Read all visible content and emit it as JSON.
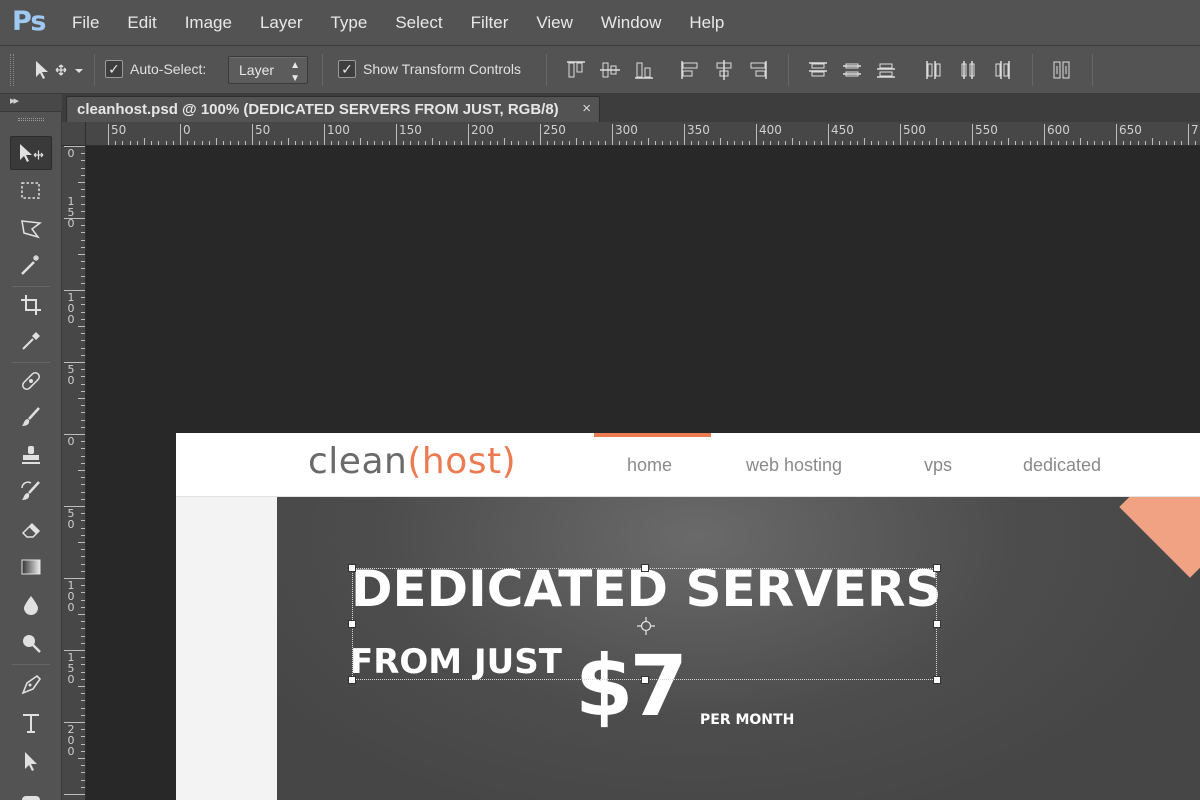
{
  "app": {
    "logo": "Ps",
    "menu": [
      "File",
      "Edit",
      "Image",
      "Layer",
      "Type",
      "Select",
      "Filter",
      "View",
      "Window",
      "Help"
    ]
  },
  "options_bar": {
    "auto_select_label": "Auto-Select:",
    "auto_select_checked": true,
    "auto_select_target": "Layer",
    "show_transform_label": "Show Transform Controls",
    "show_transform_checked": true,
    "align_icons": [
      "align-top-edges-icon",
      "align-vertical-centers-icon",
      "align-bottom-edges-icon",
      "align-left-edges-icon",
      "align-horizontal-centers-icon",
      "align-right-edges-icon",
      "distribute-top-icon",
      "distribute-vertical-centers-icon",
      "distribute-bottom-icon",
      "distribute-left-icon",
      "distribute-horizontal-centers-icon",
      "distribute-right-icon",
      "auto-align-layers-icon"
    ]
  },
  "document": {
    "tab_title": "cleanhost.psd @ 100% (DEDICATED SERVERS FROM JUST, RGB/8)",
    "close_glyph": "×"
  },
  "rulers": {
    "horizontal_labels": [
      "50",
      "0",
      "50",
      "100",
      "150",
      "200",
      "250",
      "300",
      "350",
      "400",
      "450",
      "500",
      "550",
      "600",
      "650",
      "7"
    ],
    "vertical_labels": [
      "0",
      "150",
      "100",
      "50",
      "0",
      "50",
      "100",
      "150",
      "200"
    ]
  },
  "tools": [
    "move-tool",
    "marquee-tool",
    "lasso-tool",
    "magic-wand-tool",
    "crop-tool",
    "eyedropper-tool",
    "healing-brush-tool",
    "brush-tool",
    "clone-stamp-tool",
    "history-brush-tool",
    "eraser-tool",
    "gradient-tool",
    "blur-tool",
    "dodge-tool",
    "pen-tool",
    "type-tool",
    "path-selection-tool",
    "shape-tool"
  ],
  "site": {
    "logo_main": "clean",
    "logo_accent": "(host)",
    "nav": [
      "home",
      "web hosting",
      "vps",
      "dedicated"
    ],
    "hero_title": "DEDICATED SERVERS",
    "hero_from": "FROM JUST",
    "hero_price": "$7",
    "hero_per_month": "PER MONTH"
  },
  "colors": {
    "accent": "#ec7b52",
    "ps_blue": "#9dc9f2"
  }
}
